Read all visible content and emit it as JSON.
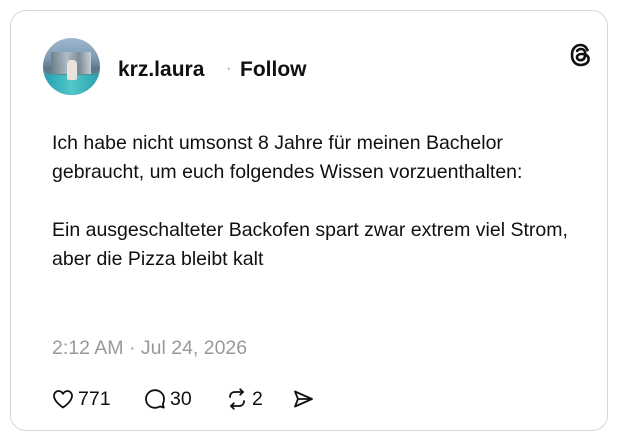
{
  "post": {
    "username": "krz.laura",
    "separator": "·",
    "follow_label": "Follow",
    "paragraphs": [
      "Ich habe nicht umsonst 8 Jahre für meinen Bachelor gebraucht, um euch folgendes Wissen vorzuenthalten:",
      "Ein ausgeschalteter Backofen spart zwar extrem viel Strom, aber die Pizza bleibt kalt"
    ],
    "timestamp": "2:12 AM · Jul 24, 2026"
  },
  "actions": {
    "likes": "771",
    "replies": "30",
    "reposts": "2"
  },
  "icons": [
    "threads-logo-icon",
    "heart-icon",
    "comment-icon",
    "repost-icon",
    "share-icon"
  ]
}
